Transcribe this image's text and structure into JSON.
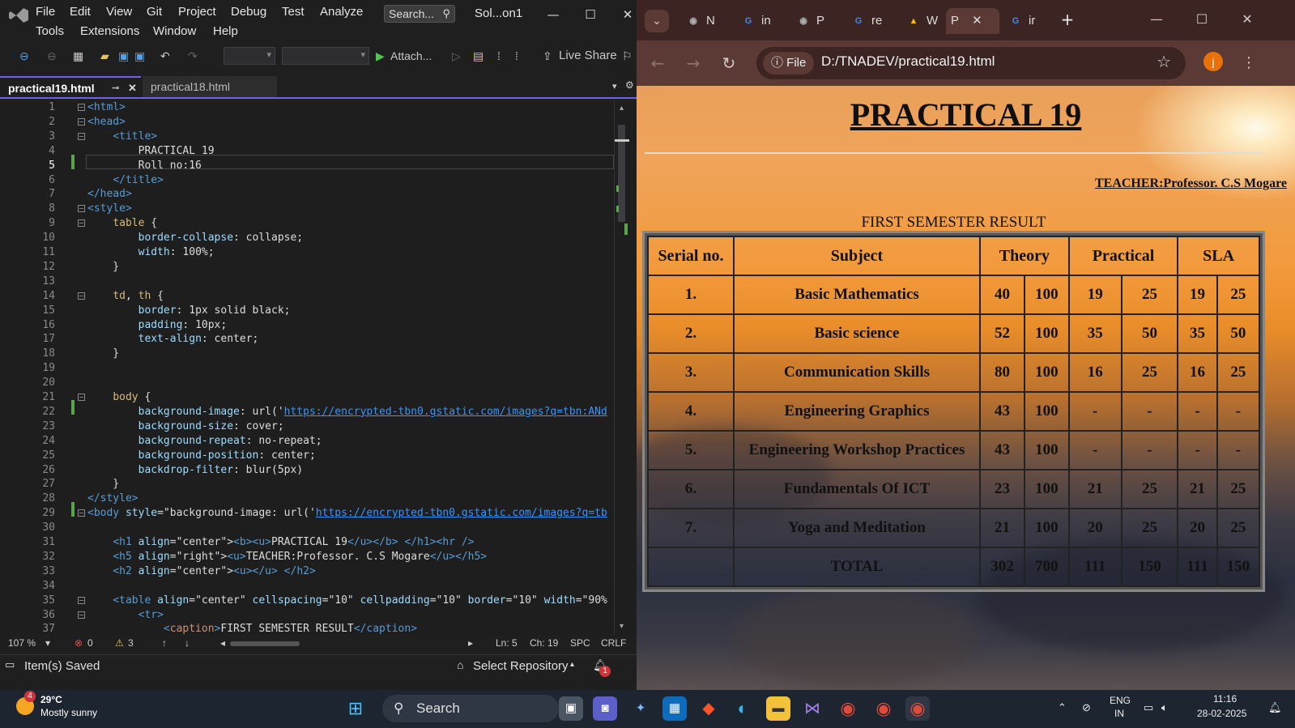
{
  "vs": {
    "menu": [
      "File",
      "Edit",
      "View",
      "Git",
      "Project",
      "Debug",
      "Test",
      "Analyze",
      "Tools",
      "Extensions",
      "Window",
      "Help"
    ],
    "search_label": "Search...",
    "solution_name": "Sol...on1",
    "toolbar": {
      "attach_label": "Attach...",
      "live_share_label": "Live Share"
    },
    "tabs": [
      {
        "label": "practical19.html"
      },
      {
        "label": "practical18.html"
      }
    ],
    "line_numbers": [
      "1",
      "2",
      "3",
      "4",
      "5",
      "6",
      "7",
      "8",
      "9",
      "10",
      "11",
      "12",
      "13",
      "14",
      "15",
      "16",
      "17",
      "18",
      "19",
      "20",
      "21",
      "22",
      "23",
      "24",
      "25",
      "26",
      "27",
      "28",
      "29",
      "30",
      "31",
      "32",
      "33",
      "34",
      "35",
      "36",
      "37"
    ],
    "zoom": "107 %",
    "errors": "0",
    "warnings": "3",
    "cursor": {
      "ln": "Ln: 5",
      "ch": "Ch: 19",
      "spc": "SPC",
      "eol": "CRLF"
    },
    "status": "Item(s) Saved",
    "select_repo": "Select Repository",
    "notif_count": "1"
  },
  "browser": {
    "tabs": [
      {
        "label": "N",
        "fav": "◉",
        "color": "#b0b0b0"
      },
      {
        "label": "in",
        "fav": "G",
        "color": "#4285f4"
      },
      {
        "label": "P",
        "fav": "◉",
        "color": "#b0b0b0"
      },
      {
        "label": "re",
        "fav": "G",
        "color": "#4285f4"
      },
      {
        "label": "W",
        "fav": "▲",
        "color": "#fbbc04"
      },
      {
        "label": "P",
        "fav": "",
        "color": "#5b3a35"
      },
      {
        "label": "ir",
        "fav": "G",
        "color": "#4285f4"
      }
    ],
    "file_chip": "File",
    "url": "D:/TNADEV/practical19.html",
    "avatar_letter": "j"
  },
  "page": {
    "heading": "PRACTICAL 19",
    "teacher": "TEACHER:Professor. C.S Mogare",
    "caption": "FIRST SEMESTER RESULT",
    "headers": [
      "Serial no.",
      "Subject",
      "Theory",
      "Practical",
      "SLA"
    ],
    "rows": [
      [
        "1.",
        "Basic Mathematics",
        "40",
        "100",
        "19",
        "25",
        "19",
        "25"
      ],
      [
        "2.",
        "Basic science",
        "52",
        "100",
        "35",
        "50",
        "35",
        "50"
      ],
      [
        "3.",
        "Communication Skills",
        "80",
        "100",
        "16",
        "25",
        "16",
        "25"
      ],
      [
        "4.",
        "Engineering Graphics",
        "43",
        "100",
        "-",
        "-",
        "-",
        "-"
      ],
      [
        "5.",
        "Engineering Workshop Practices",
        "43",
        "100",
        "-",
        "-",
        "-",
        "-"
      ],
      [
        "6.",
        "Fundamentals Of ICT",
        "23",
        "100",
        "21",
        "25",
        "21",
        "25"
      ],
      [
        "7.",
        "Yoga and Meditation",
        "21",
        "100",
        "20",
        "25",
        "20",
        "25"
      ],
      [
        "",
        "TOTAL",
        "302",
        "700",
        "111",
        "150",
        "111",
        "150"
      ]
    ]
  },
  "taskbar": {
    "temp": "29°C",
    "weather": "Mostly sunny",
    "weather_badge": "4",
    "search": "Search",
    "lang1": "ENG",
    "lang2": "IN",
    "time": "11:16",
    "date": "28-02-2025"
  }
}
